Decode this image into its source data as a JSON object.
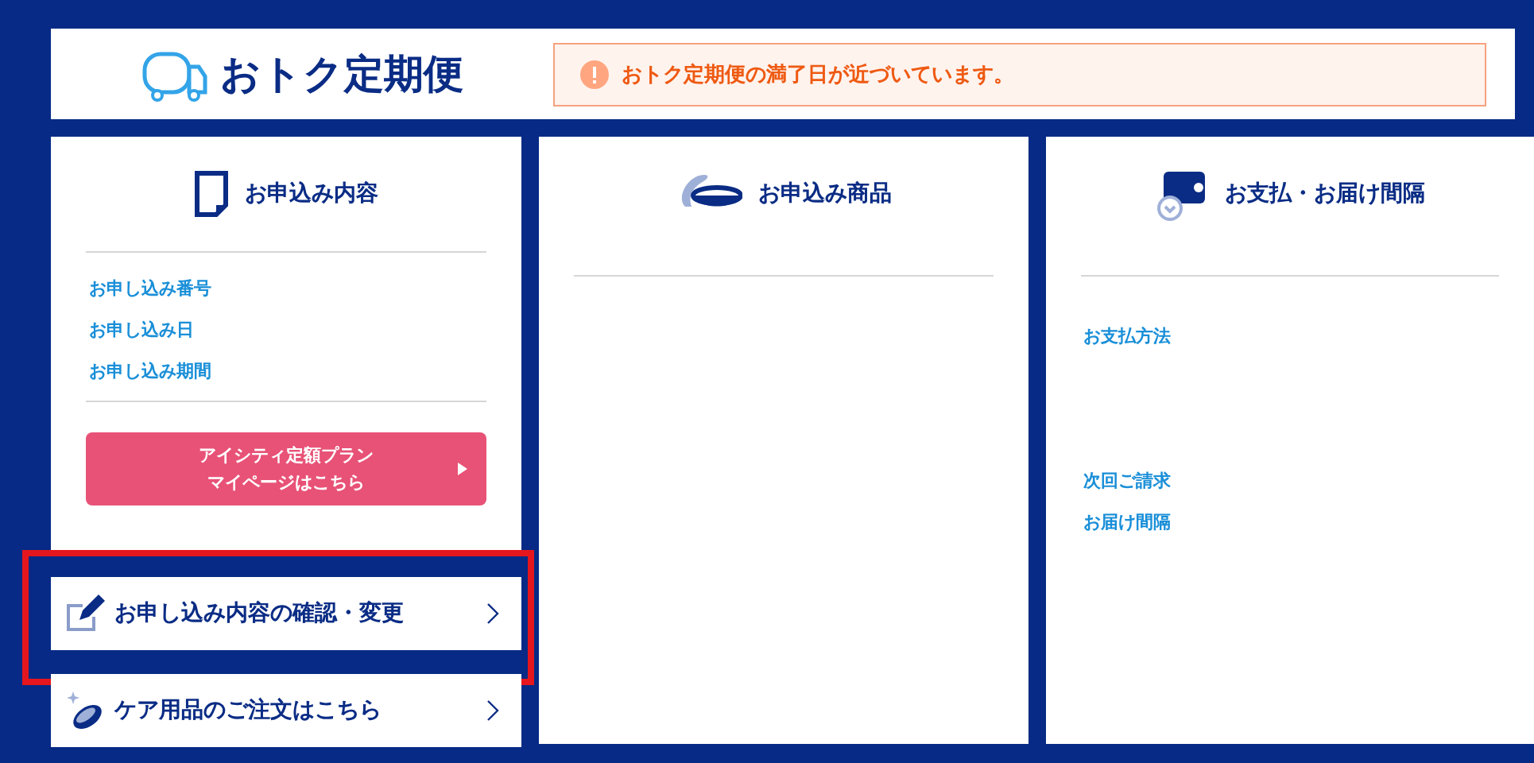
{
  "header": {
    "logo_text": "おトク定期便",
    "alert": {
      "text": "おトク定期便の満了日が近づいています。"
    }
  },
  "panels": [
    {
      "title": "お申込み内容",
      "groups": [
        [
          "お申し込み番号",
          "お申し込み日",
          "お申し込み期間"
        ]
      ],
      "button": {
        "line1": "アイシティ定額プラン",
        "line2": "マイページはこちら"
      }
    },
    {
      "title": "お申込み商品"
    },
    {
      "title": "お支払・お届け間隔",
      "groups": [
        [
          "お支払方法"
        ],
        [
          "次回ご請求",
          "お届け間隔"
        ]
      ]
    }
  ],
  "links": [
    {
      "label": "お申し込み内容の確認・変更",
      "highlighted": true
    },
    {
      "label": "ケア用品のご注文はこちら",
      "highlighted": false
    }
  ]
}
